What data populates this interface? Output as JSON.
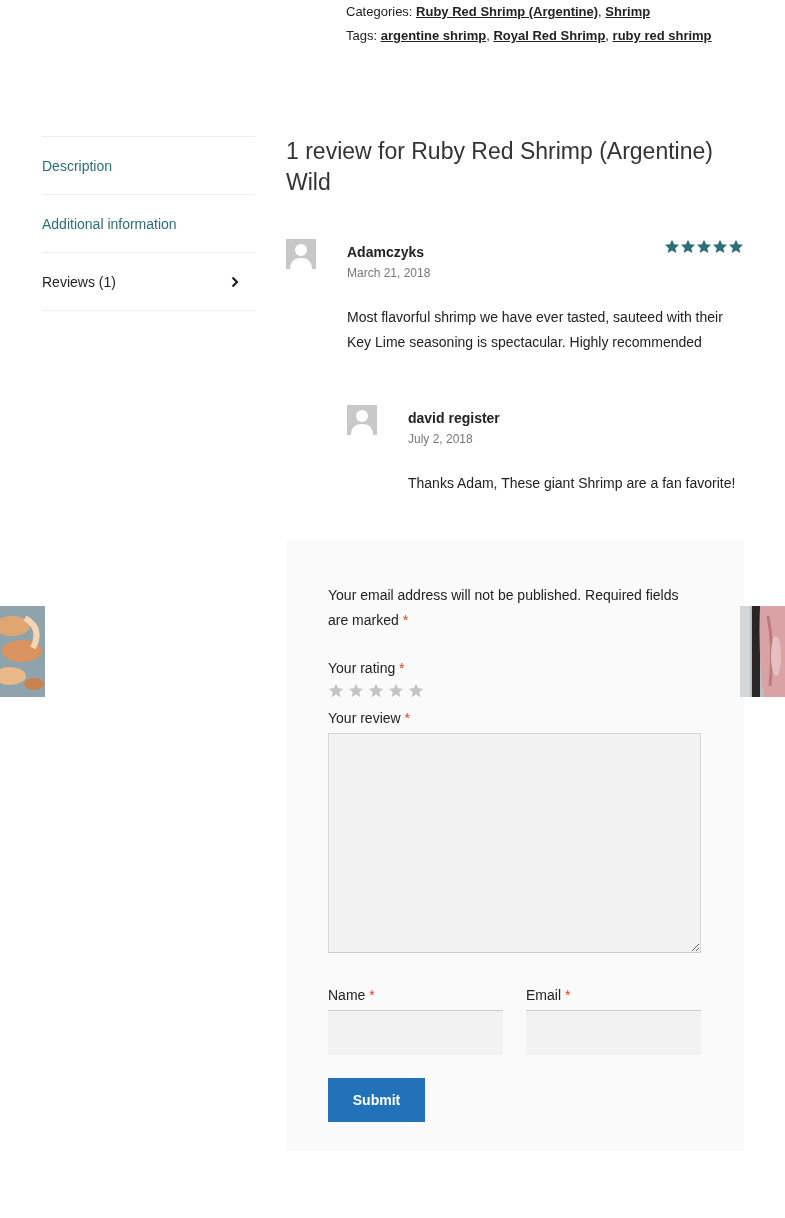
{
  "meta": [
    {
      "label": "Categories:",
      "links": [
        {
          "text": "Ruby Red Shrimp (Argentine)",
          "sep": ","
        },
        {
          "text": "Shrimp"
        }
      ]
    },
    {
      "label": "Tags:",
      "links": [
        {
          "text": "argentine shrimp",
          "sep": ","
        },
        {
          "text": "Royal Red Shrimp",
          "sep": ","
        },
        {
          "text": "ruby red shrimp"
        }
      ]
    }
  ],
  "tabs": [
    {
      "label": "Description",
      "selected": false
    },
    {
      "label": "Additional information",
      "selected": false
    },
    {
      "label": "Reviews (1)",
      "selected": true
    }
  ],
  "reviews_title": "1 review for Ruby Red Shrimp (Argentine) Wild",
  "reviews": [
    {
      "author": "Adamczyks",
      "date": "March 21, 2018",
      "stars": 5,
      "text": "Most flavorful shrimp we have ever tasted, sauteed with their Key Lime seasoning is spectacular. Highly recommended",
      "children": [
        {
          "author": "david register",
          "date": "July 2, 2018",
          "text": "Thanks Adam, These giant Shrimp are a fan favorite!"
        }
      ]
    }
  ],
  "form": {
    "notice": {
      "text": "Your email address will not be published. Required fields are marked",
      "mark": "*"
    },
    "rating_label": {
      "text": "Your rating",
      "mark": "*"
    },
    "rating": {
      "stars": 0
    },
    "review_label": {
      "text": "Your review",
      "mark": "*"
    },
    "name_label": {
      "text": "Name",
      "mark": "*"
    },
    "email_label": {
      "text": "Email",
      "mark": "*"
    },
    "submit": "Submit"
  }
}
